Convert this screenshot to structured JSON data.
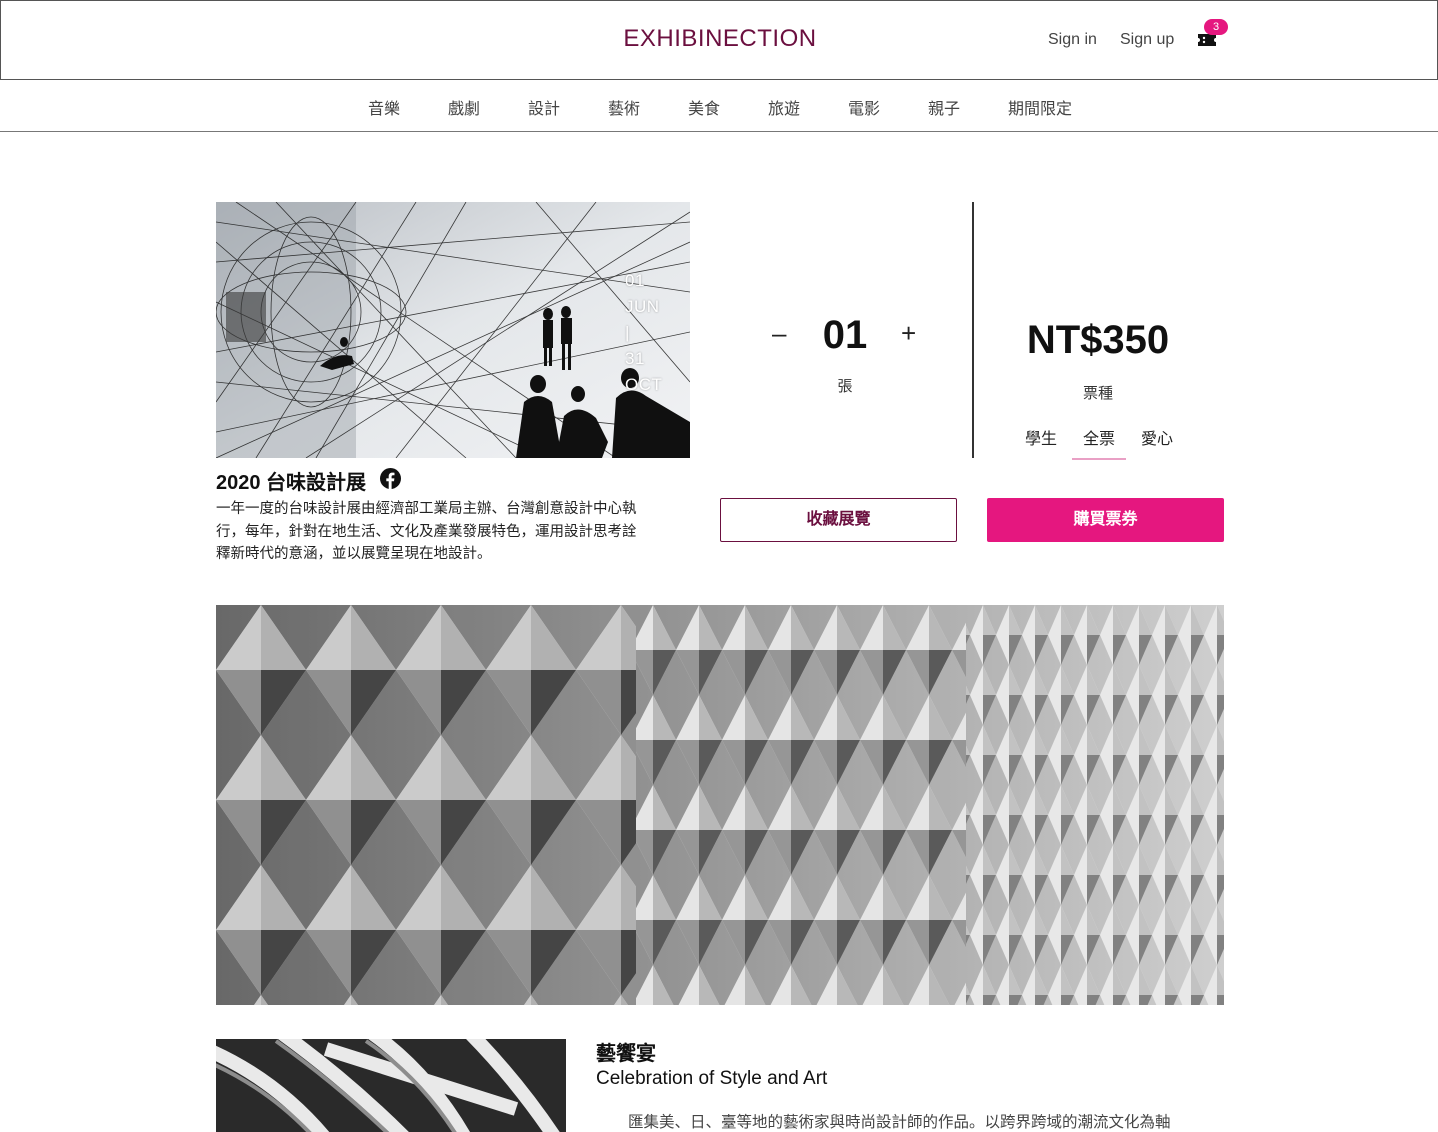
{
  "header": {
    "brand": "EXHIBINECTION",
    "sign_in": "Sign in",
    "sign_up": "Sign up",
    "cart_icon": "ticket-cart-icon",
    "cart_count": "3"
  },
  "categories": [
    "音樂",
    "戲劇",
    "設計",
    "藝術",
    "美食",
    "旅遊",
    "電影",
    "親子",
    "期間限定"
  ],
  "exhibition": {
    "date_lines": [
      "01",
      "JUN",
      "|",
      "31",
      "OCT"
    ],
    "title": "2020 台味設計展",
    "share_icon": "facebook-icon",
    "description_lines": [
      "一年一度的台味設計展由經濟部工業局主辦、台灣創意設計中心執",
      "行，每年，針對在地生活、文化及產業發展特色，運用設計思考詮",
      "釋新時代的意涵，並以展覽呈現在地設計。"
    ]
  },
  "purchase": {
    "qty_minus": "–",
    "qty_value": "01",
    "qty_plus": "+",
    "qty_unit": "張",
    "price": "NT$350",
    "ticket_type_label": "票種",
    "ticket_options": [
      "學生",
      "全票",
      "愛心"
    ],
    "selected_option": "全票",
    "favorite_label": "收藏展覽",
    "buy_label": "購買票券"
  },
  "section": {
    "title": "藝饗宴",
    "subtitle": "Celebration of Style and Art",
    "description": "匯集美、日、臺等地的藝術家與時尚設計師的作品。以跨界跨域的潮流文化為軸"
  },
  "colors": {
    "brand": "#6b0f3f",
    "accent": "#e5177f",
    "active_underline": "#e9a0c5"
  }
}
